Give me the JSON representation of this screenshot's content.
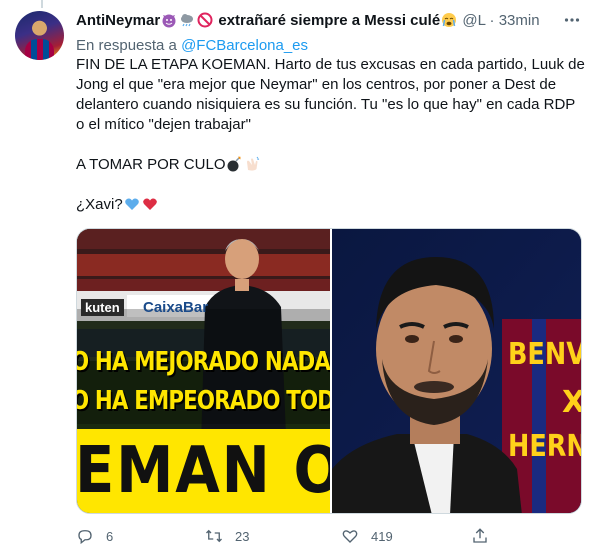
{
  "tweet": {
    "display_name": "AntiNeymar",
    "display_name_suffix": "extrañaré siempre a Messi culé",
    "handle": "@L",
    "separator": "·",
    "time": "33min",
    "reply_prefix": "En respuesta a",
    "reply_handle": "@FCBarcelona_es",
    "paragraphs": [
      "FIN DE LA ETAPA KOEMAN. Harto de tus excusas en cada partido,  Luuk de Jong el que \"era mejor que Neymar\" en los centros, por poner a Dest de delantero cuando nisiquiera es su función. Tu \"es lo que hay\" en cada RDP o el mítico \"dejen trabajar\"",
      "A TOMAR POR CULO",
      "¿Xavi?"
    ],
    "media": {
      "left": {
        "overlay_line1": "O HA MEJORADO NADA",
        "overlay_line2": "O HA EMPEORADO TODO",
        "big_text": "EMAN O",
        "sponsor": "CaixaBar",
        "hoarding": "kuten"
      },
      "right": {
        "line1": "BENV",
        "line2": "X",
        "line3": "HERN"
      }
    },
    "actions": {
      "replies": "6",
      "retweets": "23",
      "likes": "419"
    }
  },
  "colors": {
    "accent": "#1d9bf0",
    "muted": "#536471",
    "text": "#0f1419",
    "overlay_yellow": "#ffe600",
    "heart_red": "#e0245e",
    "heart_blue": "#5dadec"
  }
}
